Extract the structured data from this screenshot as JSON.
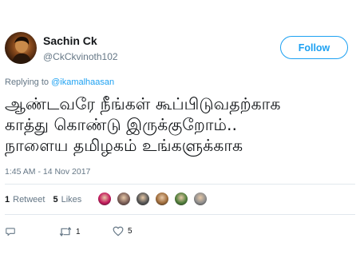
{
  "user": {
    "display_name": "Sachin Ck",
    "handle": "@CkCkvinoth102"
  },
  "follow_button": {
    "label": "Follow"
  },
  "reply_context": {
    "prefix": "Replying to ",
    "mention": "@ikamalhaasan"
  },
  "tweet": {
    "lines": [
      "ஆண்டவரே நீங்கள் கூப்பிடுவதற்காக",
      "காத்து கொண்டு இருக்குறோம்..",
      "நாளைய தமிழகம் உங்களுக்காக"
    ],
    "timestamp": "1:45 AM - 14 Nov 2017"
  },
  "stats": {
    "retweets_count": "1",
    "retweets_label": "Retweet",
    "likes_count": "5",
    "likes_label": "Likes"
  },
  "likers": [
    {
      "icon": "liker-avatar-1",
      "color": "#c2185b"
    },
    {
      "icon": "liker-avatar-2",
      "color": "#7b5e57"
    },
    {
      "icon": "liker-avatar-3",
      "color": "#555555"
    },
    {
      "icon": "liker-avatar-4",
      "color": "#9e6b3a"
    },
    {
      "icon": "liker-avatar-5",
      "color": "#4e7d3a"
    },
    {
      "icon": "liker-avatar-6",
      "color": "#8d8d8d"
    }
  ],
  "actions": {
    "reply_icon": "reply-icon",
    "retweet_icon": "retweet-icon",
    "retweet_count": "1",
    "like_icon": "heart-icon",
    "like_count": "5"
  },
  "colors": {
    "accent": "#1da1f2",
    "secondary_text": "#657786",
    "divider": "#e1e8ed"
  }
}
